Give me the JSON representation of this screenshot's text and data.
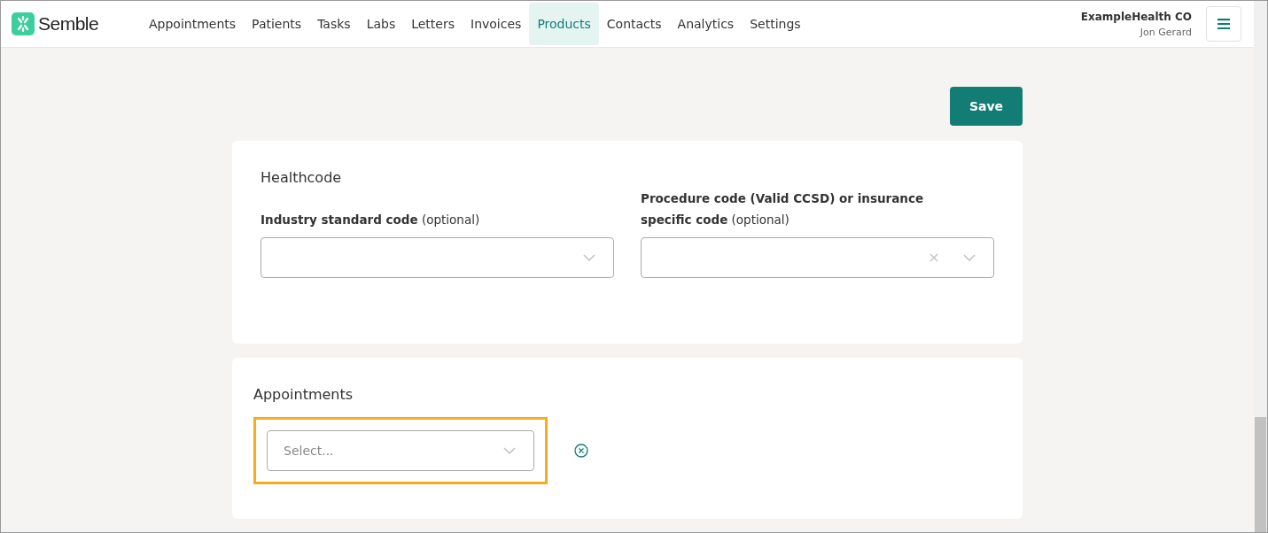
{
  "brand": {
    "name": "Semble"
  },
  "nav": [
    {
      "label": "Appointments",
      "selected": false
    },
    {
      "label": "Patients",
      "selected": false
    },
    {
      "label": "Tasks",
      "selected": false
    },
    {
      "label": "Labs",
      "selected": false
    },
    {
      "label": "Letters",
      "selected": false
    },
    {
      "label": "Invoices",
      "selected": false
    },
    {
      "label": "Products",
      "selected": true
    },
    {
      "label": "Contacts",
      "selected": false
    },
    {
      "label": "Analytics",
      "selected": false
    },
    {
      "label": "Settings",
      "selected": false
    }
  ],
  "account": {
    "organisation": "ExampleHealth CO",
    "user": "Jon Gerard"
  },
  "save_button": "Save",
  "healthcode": {
    "title": "Healthcode",
    "fields": [
      {
        "label": "**Industry standard code** (optional)",
        "clearable": false
      },
      {
        "label": "**Procedure code (Valid CCSD) or insurance specific code** (optional)",
        "clearable": true
      }
    ]
  },
  "appointments": {
    "title": "Appointments",
    "select": {
      "placeholder": "Select...",
      "highlighted": true
    }
  }
}
